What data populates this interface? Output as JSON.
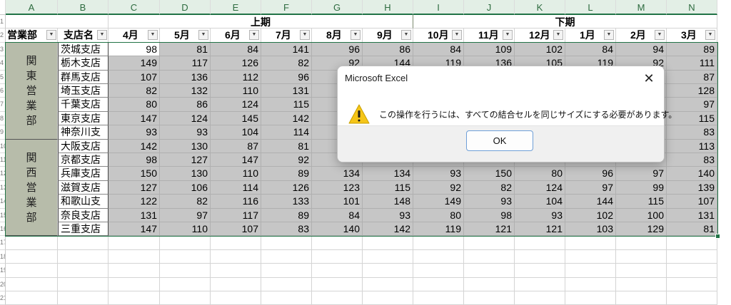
{
  "app": {
    "name": "Microsoft Excel"
  },
  "sheet": {
    "columns": [
      "A",
      "B",
      "C",
      "D",
      "E",
      "F",
      "G",
      "H",
      "I",
      "J",
      "K",
      "L",
      "M",
      "N"
    ],
    "row_numbers": [
      "1",
      "2",
      "3",
      "4",
      "5",
      "6",
      "7",
      "8",
      "9",
      "10",
      "11",
      "12",
      "13",
      "14",
      "15",
      "16",
      "17",
      "18",
      "19",
      "20",
      "21"
    ],
    "headers": {
      "department": "営業部",
      "branch": "支店名",
      "first_half": "上期",
      "second_half": "下期",
      "months": [
        "4月",
        "5月",
        "6月",
        "7月",
        "8月",
        "9月",
        "10月",
        "11月",
        "12月",
        "1月",
        "2月",
        "3月"
      ]
    },
    "departments": [
      {
        "name": [
          "関",
          "東",
          "営",
          "業",
          "部"
        ]
      },
      {
        "name": [
          "関",
          "西",
          "営",
          "業",
          "部"
        ]
      }
    ],
    "rows": [
      {
        "branch": "茨城支店",
        "values": [
          "98",
          "81",
          "84",
          "141",
          "96",
          "86",
          "84",
          "109",
          "102",
          "84",
          "94",
          "89"
        ]
      },
      {
        "branch": "栃木支店",
        "values": [
          "149",
          "117",
          "126",
          "82",
          "92",
          "144",
          "119",
          "136",
          "105",
          "119",
          "92",
          "111"
        ]
      },
      {
        "branch": "群馬支店",
        "values": [
          "107",
          "136",
          "112",
          "96",
          "",
          "",
          "",
          "",
          "",
          "",
          "",
          "87"
        ]
      },
      {
        "branch": "埼玉支店",
        "values": [
          "82",
          "132",
          "110",
          "131",
          "",
          "",
          "",
          "",
          "",
          "",
          "",
          "128"
        ]
      },
      {
        "branch": "千葉支店",
        "values": [
          "80",
          "86",
          "124",
          "115",
          "",
          "",
          "",
          "",
          "",
          "",
          "",
          "97"
        ]
      },
      {
        "branch": "東京支店",
        "values": [
          "147",
          "124",
          "145",
          "142",
          "",
          "",
          "",
          "",
          "",
          "",
          "",
          "115"
        ]
      },
      {
        "branch": "神奈川支",
        "values": [
          "93",
          "93",
          "104",
          "114",
          "",
          "",
          "",
          "",
          "",
          "",
          "",
          "83"
        ]
      },
      {
        "branch": "大阪支店",
        "values": [
          "142",
          "130",
          "87",
          "81",
          "",
          "",
          "",
          "",
          "",
          "",
          "",
          "113"
        ]
      },
      {
        "branch": "京都支店",
        "values": [
          "98",
          "127",
          "147",
          "92",
          "",
          "",
          "",
          "",
          "",
          "",
          "",
          "83"
        ]
      },
      {
        "branch": "兵庫支店",
        "values": [
          "150",
          "130",
          "110",
          "89",
          "134",
          "134",
          "93",
          "150",
          "80",
          "96",
          "97",
          "140"
        ]
      },
      {
        "branch": "滋賀支店",
        "values": [
          "127",
          "106",
          "114",
          "126",
          "123",
          "115",
          "92",
          "82",
          "124",
          "97",
          "99",
          "139"
        ]
      },
      {
        "branch": "和歌山支",
        "values": [
          "122",
          "82",
          "116",
          "133",
          "101",
          "148",
          "149",
          "93",
          "104",
          "144",
          "115",
          "107"
        ]
      },
      {
        "branch": "奈良支店",
        "values": [
          "131",
          "97",
          "117",
          "89",
          "84",
          "93",
          "80",
          "98",
          "93",
          "102",
          "100",
          "131"
        ]
      },
      {
        "branch": "三重支店",
        "values": [
          "147",
          "110",
          "107",
          "83",
          "140",
          "142",
          "119",
          "121",
          "121",
          "103",
          "129",
          "81"
        ]
      }
    ]
  },
  "dialog": {
    "title": "Microsoft Excel",
    "message": "この操作を行うには、すべての結合セルを同じサイズにする必要があります。",
    "ok_label": "OK",
    "close_glyph": "✕",
    "icon": "warning-icon"
  },
  "colors": {
    "selection": "#217346",
    "range_fill": "#c6c6c6",
    "dept_fill": "#b7bcaa"
  }
}
